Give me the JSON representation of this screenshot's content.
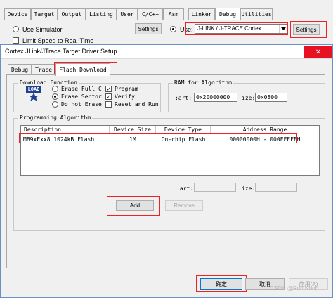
{
  "options_window": {
    "tabs": [
      "Device",
      "Target",
      "Output",
      "Listing",
      "User",
      "C/C++",
      "Asm",
      "Linker",
      "Debug",
      "Utilities"
    ],
    "active_tab": "Debug",
    "use_simulator_label": "Use Simulator",
    "limit_speed_label": "Limit Speed to Real-Time",
    "settings_left_label": "Settings",
    "use_label": "Use:",
    "debugger_value": "J-LINK / J-TRACE Cortex",
    "settings_right_label": "Settings"
  },
  "dialog": {
    "title": "Cortex JLink/JTrace Target Driver Setup",
    "close_glyph": "✕",
    "tabs": [
      "Debug",
      "Trace",
      "Flash Download"
    ],
    "active_tab": "Flash Download",
    "download_function": {
      "title": "Download Function",
      "icon_text": "LOAD",
      "radios": [
        {
          "label": "Erase Full C",
          "checked": false
        },
        {
          "label": "Erase Sector",
          "checked": true
        },
        {
          "label": "Do not Erase",
          "checked": false
        }
      ],
      "checks": [
        {
          "label": "Program",
          "checked": true
        },
        {
          "label": "Verify",
          "checked": true
        },
        {
          "label": "Reset and Run",
          "checked": false
        }
      ],
      "check_mark": "✓"
    },
    "ram": {
      "title": "RAM for Algorithm",
      "start_label": ":art:",
      "start_value": "0x20000000",
      "size_label": "ize:",
      "size_value": "0x0800"
    },
    "programming": {
      "title": "Programming Algorithm",
      "columns": [
        "Description",
        "Device Size",
        "Device Type",
        "Address Range"
      ],
      "rows": [
        {
          "description": "MB9xFxx8 1024kB Flash",
          "size": "1M",
          "type": "On-chip Flash",
          "range": "00000000H - 000FFFFFH"
        }
      ],
      "start_label": ":art:",
      "size_label": "ize:"
    },
    "add_label": "Add",
    "remove_label": "Remove",
    "ok_label": "确定",
    "cancel_label": "取消",
    "apply_label": "应用(A)"
  },
  "watermark": "CSDN @Run Noob",
  "colors": {
    "highlight": "#e22222",
    "load_icon": "#1f3f8f"
  }
}
